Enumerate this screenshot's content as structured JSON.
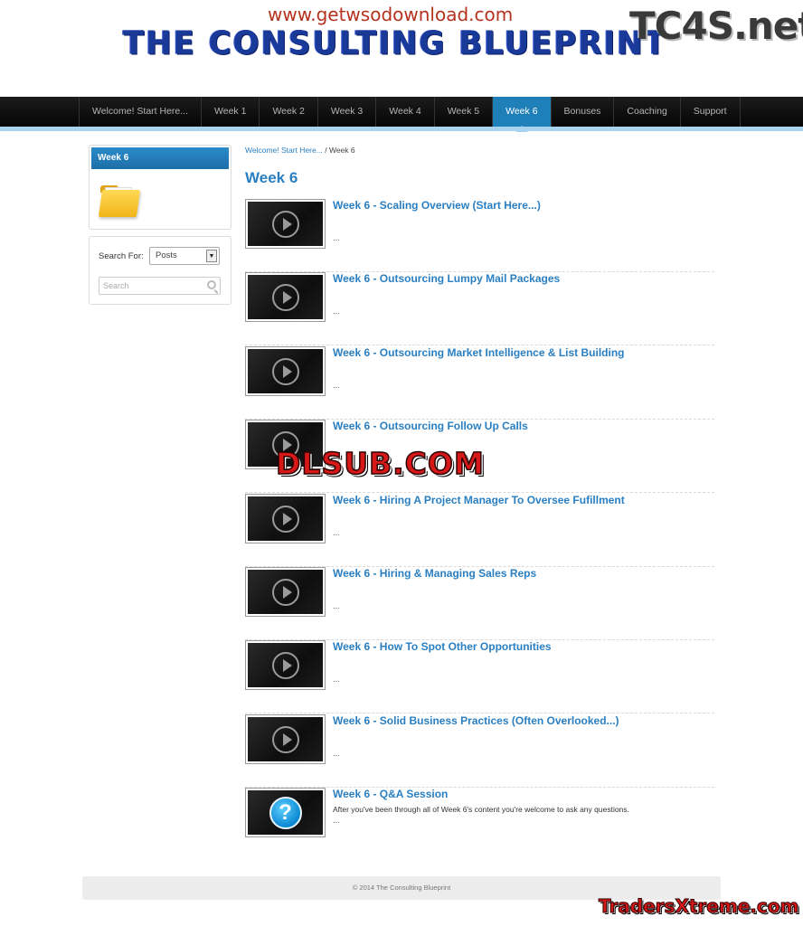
{
  "watermarks": {
    "top_url": "www.getwsodownload.com",
    "tc4s": "TC4S.net",
    "dlsub": "DLSUB.COM",
    "traders": "TradersXtreme.com"
  },
  "header": {
    "site_title": "THE CONSULTING BLUEPRINT"
  },
  "nav": {
    "items": [
      "Welcome! Start Here...",
      "Week 1",
      "Week 2",
      "Week 3",
      "Week 4",
      "Week 5",
      "Week 6",
      "Bonuses",
      "Coaching",
      "Support"
    ],
    "active": "Week 6"
  },
  "sidebar": {
    "week_widget_title": "Week 6",
    "search_label": "Search For:",
    "search_select_value": "Posts",
    "search_placeholder": "Search"
  },
  "breadcrumb": {
    "link": "Welcome! Start Here...",
    "separator": "/",
    "current": "Week 6"
  },
  "page_title": "Week 6",
  "posts": [
    {
      "title": "Week 6 - Scaling Overview (Start Here...)",
      "excerpt": "",
      "more": "...",
      "thumb": "play-icon"
    },
    {
      "title": "Week 6 - Outsourcing Lumpy Mail Packages",
      "excerpt": "",
      "more": "...",
      "thumb": "play-icon"
    },
    {
      "title": "Week 6 - Outsourcing Market Intelligence & List Building",
      "excerpt": "",
      "more": "...",
      "thumb": "play-icon"
    },
    {
      "title": "Week 6 - Outsourcing Follow Up Calls",
      "excerpt": "",
      "more": "...",
      "thumb": "play-icon"
    },
    {
      "title": "Week 6 - Hiring A Project Manager To Oversee Fufillment",
      "excerpt": "",
      "more": "...",
      "thumb": "play-icon"
    },
    {
      "title": "Week 6 - Hiring & Managing Sales Reps",
      "excerpt": "",
      "more": "...",
      "thumb": "play-icon"
    },
    {
      "title": "Week 6 - How To Spot Other Opportunities",
      "excerpt": "",
      "more": "...",
      "thumb": "play-icon"
    },
    {
      "title": "Week 6 - Solid Business Practices (Often Overlooked...)",
      "excerpt": "",
      "more": "...",
      "thumb": "play-icon"
    },
    {
      "title": "Week 6 - Q&A Session",
      "excerpt": "After you've been through all of Week 6's content you're welcome to ask any questions.",
      "more": "...",
      "thumb": "question-icon"
    }
  ],
  "footer": {
    "text": "© 2014 The Consulting Blueprint"
  },
  "colors": {
    "link_blue": "#2a7fc2",
    "nav_active": "#1f7fb8",
    "nav_bg": "#0a0a0a",
    "nav_underline": "#a8d3ee"
  }
}
